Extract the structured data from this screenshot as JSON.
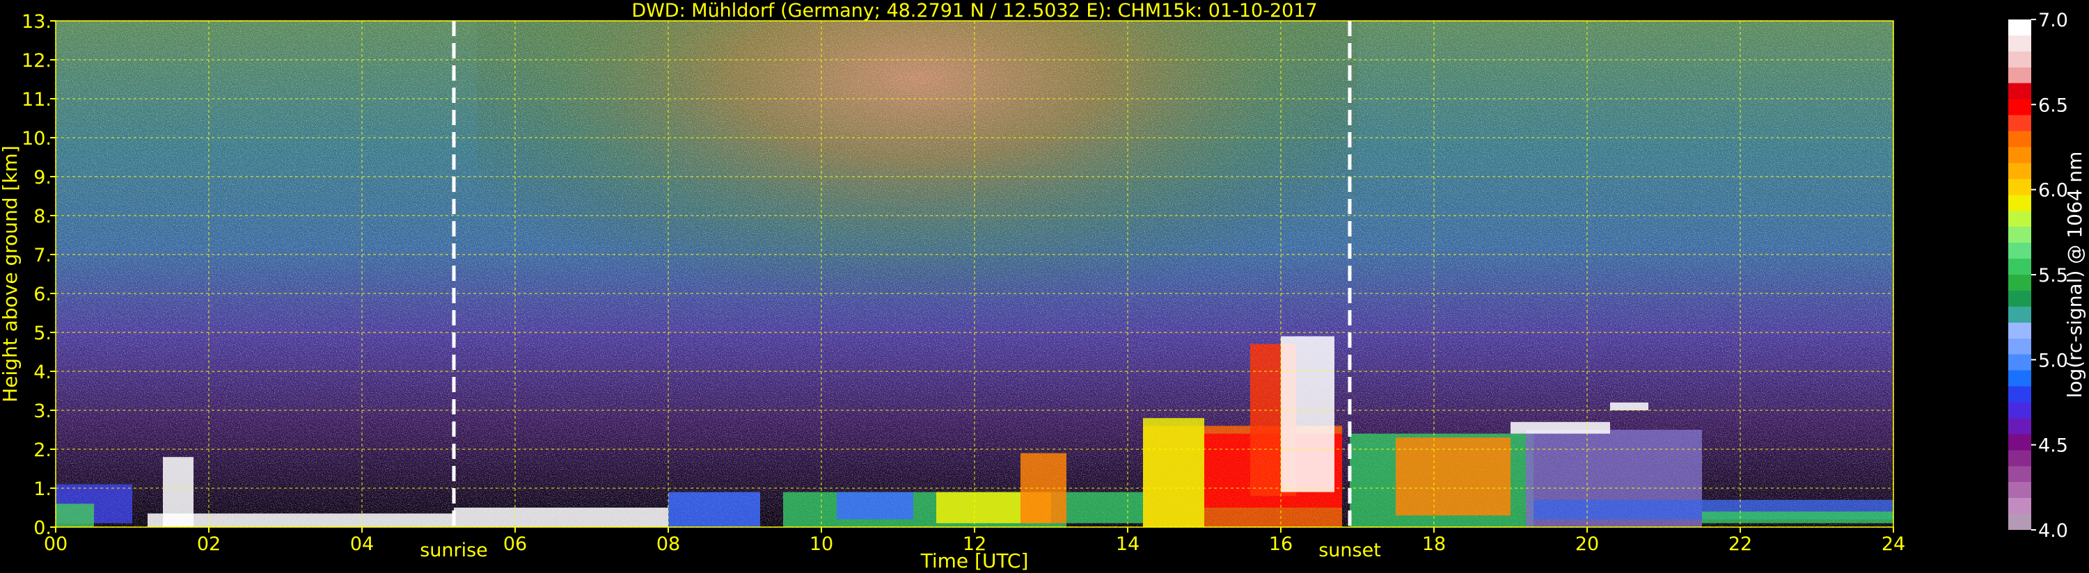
{
  "chart_data": {
    "type": "heatmap",
    "title": "DWD: Mühldorf (Germany; 48.2791 N / 12.5032 E):    CHM15k: 01-10-2017",
    "xlabel": "Time [UTC]",
    "ylabel": "Height above ground [km]",
    "xlim": [
      0,
      24
    ],
    "ylim": [
      0,
      13
    ],
    "x_ticks": [
      "00",
      "02",
      "04",
      "06",
      "08",
      "10",
      "12",
      "14",
      "16",
      "18",
      "20",
      "22",
      "24"
    ],
    "y_ticks": [
      "0.",
      "1.",
      "2.",
      "3.",
      "4.",
      "5.",
      "6.",
      "7.",
      "8.",
      "9.",
      "10.",
      "11.",
      "12.",
      "13."
    ],
    "grid": true,
    "annotations": [
      {
        "label": "sunrise",
        "x": 5.2
      },
      {
        "label": "sunset",
        "x": 16.9
      }
    ],
    "colorbar": {
      "label": "log(rc-signal) @ 1064 nm",
      "min": 4.0,
      "max": 7.0,
      "ticks": [
        "4.0",
        "4.5",
        "5.0",
        "5.5",
        "6.0",
        "6.5",
        "7.0"
      ],
      "colors": [
        "#b49ab4",
        "#c28cc0",
        "#ad6aad",
        "#9c4a9c",
        "#8a2a8c",
        "#7a0c84",
        "#6a1ab8",
        "#4a2ae0",
        "#2a40f0",
        "#1a70ff",
        "#4a8cff",
        "#7aa4ff",
        "#9ab8ff",
        "#3aa8a0",
        "#1a9a50",
        "#2ab040",
        "#3ac860",
        "#60e080",
        "#90f070",
        "#c0f840",
        "#f0f000",
        "#ffd000",
        "#ffb000",
        "#ff9000",
        "#ff7000",
        "#ff4020",
        "#ff0000",
        "#e00010",
        "#f0a0a0",
        "#f4c8c8",
        "#f8e4e4",
        "#ffffff"
      ]
    }
  }
}
